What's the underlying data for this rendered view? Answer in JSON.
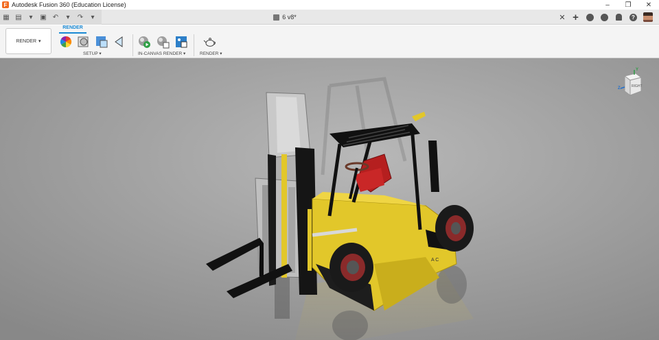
{
  "app": {
    "title": "Autodesk Fusion 360 (Education License)",
    "logo_letter": "F",
    "window_controls": {
      "minimize": "–",
      "restore": "❐",
      "close": "✕"
    }
  },
  "quick_access": {
    "grid_icon": "▦",
    "file_icon": "▤",
    "dropdown_icon": "▾",
    "save_icon": "▣",
    "undo_icon": "↶",
    "redo_icon": "↷"
  },
  "document_tab": {
    "name": "6 v8*",
    "close": "✕",
    "new_tab": "+",
    "help_glyph": "?"
  },
  "toolbar": {
    "workspace_label": "RENDER",
    "workspace_caret": "▾",
    "active_tab": "RENDER",
    "groups": {
      "setup": "SETUP ▾",
      "in_canvas": "IN-CANVAS RENDER ▾",
      "render": "RENDER ▾"
    }
  },
  "viewcube": {
    "face_label": "RIGHT",
    "axis_z": "Z",
    "axis_y": "Y"
  },
  "colors": {
    "accent": "#1a8ad4",
    "forklift_body": "#e2c72a",
    "viewport_bg": "#9c9c9c",
    "seat": "#b51f1f"
  }
}
